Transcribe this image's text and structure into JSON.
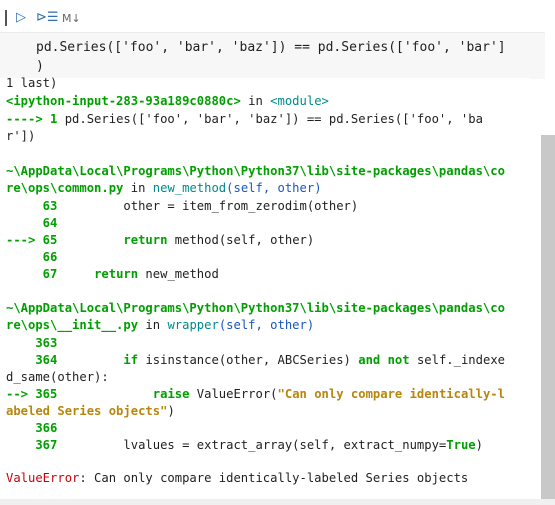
{
  "toolbar": {
    "run_icon": "▷",
    "format_icon": "⊳☰",
    "markdown_label": "M↓"
  },
  "code": {
    "line1": "pd.Series(['foo', 'bar', 'baz']) == pd.Series(['foo', 'bar']",
    "line2": ")"
  },
  "tb": {
    "l1": "1 last)",
    "l2_a": "<ipython-input-283-93a189c0880c>",
    "l2_b": " in ",
    "l2_c": "<module>",
    "l3_arrow": "----> 1",
    "l3_rest": " pd.Series(['foo', 'bar', 'baz']) == pd.Series(['foo', 'ba",
    "l4": "r'])",
    "p1_a": "~\\AppData\\Local\\Programs\\Python\\Python37\\lib\\site-packages\\pandas\\co",
    "p1_b": "re\\ops\\common.py",
    "p1_in": " in ",
    "p1_func": "new_method",
    "p1_args": "(self, other)",
    "n63": "     63",
    "c63": "         other = item_from_zerodim(other)",
    "n64": "     64",
    "n65": "---> 65",
    "c65_kw": "return",
    "c65": " method(self, other)",
    "n66": "     66",
    "n67": "     67",
    "c67_kw": "return",
    "c67": " new_method",
    "p2_a": "~\\AppData\\Local\\Programs\\Python\\Python37\\lib\\site-packages\\pandas\\co",
    "p2_b": "re\\ops\\__init__.py",
    "p2_in": " in ",
    "p2_func": "wrapper",
    "p2_args": "(self, other)",
    "n363": "    363",
    "n364": "    364",
    "c364_if": "if",
    "c364_a": " isinstance(other, ABCSeries) ",
    "c364_and": "and",
    "c364_not": "not",
    "c364_b": " self._indexe",
    "c364_cont": "d_same(other):",
    "n365": "--> 365",
    "c365_kw": "raise",
    "c365_a": " ValueError(",
    "c365_str": "\"Can only compare identically-l",
    "c365_str2": "abeled Series objects\"",
    "c365_end": ")",
    "n366": "    366",
    "n367": "    367",
    "c367_a": "         lvalues = extract_array(self, extract_numpy=",
    "c367_true": "True",
    "c367_end": ")",
    "err_name": "ValueError",
    "err_msg": ": Can only compare identically-labeled Series objects"
  }
}
